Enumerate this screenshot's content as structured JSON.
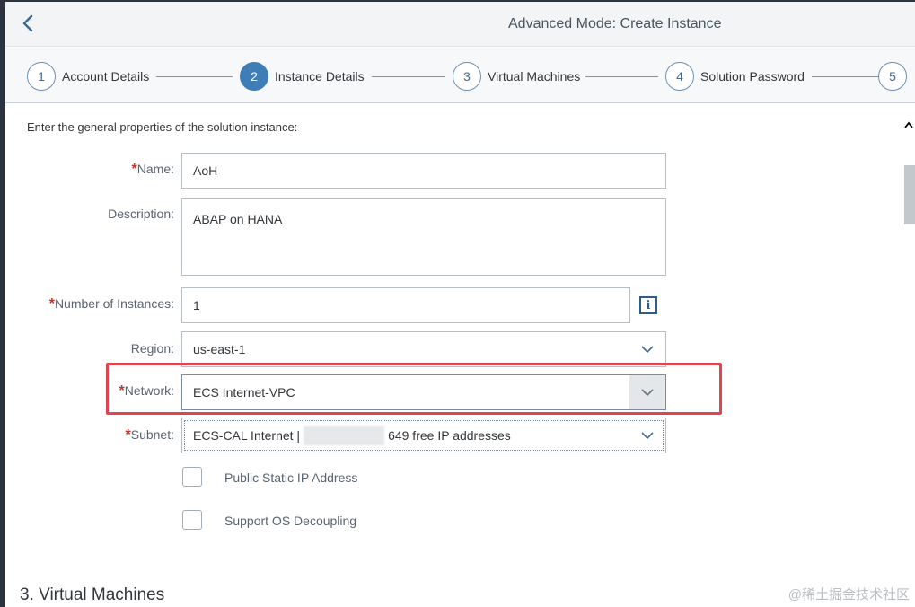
{
  "header": {
    "title": "Advanced Mode: Create Instance"
  },
  "wizard": {
    "steps": [
      {
        "number": "1",
        "label": "Account Details"
      },
      {
        "number": "2",
        "label": "Instance Details"
      },
      {
        "number": "3",
        "label": "Virtual Machines"
      },
      {
        "number": "4",
        "label": "Solution Password"
      },
      {
        "number": "5",
        "label": ""
      }
    ],
    "active_step": "2"
  },
  "form": {
    "intro": "Enter the general properties of the solution instance:",
    "required_mark": "*",
    "name": {
      "label": "Name:",
      "value": "AoH"
    },
    "description": {
      "label": "Description:",
      "value": "ABAP on HANA"
    },
    "instances": {
      "label": "Number of Instances:",
      "value": "1"
    },
    "region": {
      "label": "Region:",
      "value": "us-east-1"
    },
    "network": {
      "label": "Network:",
      "value": "ECS Internet-VPC"
    },
    "subnet": {
      "label": "Subnet:",
      "value_prefix": "ECS-CAL Internet |",
      "value_suffix": "649 free IP addresses"
    },
    "public_ip": {
      "label": "Public Static IP Address",
      "checked": false
    },
    "os_decoupling": {
      "label": "Support OS Decoupling",
      "checked": false
    }
  },
  "sections": {
    "next_title": "3. Virtual Machines"
  },
  "icons": {
    "back": "back-arrow-icon",
    "info": "info-icon",
    "dropdown": "chevron-down-icon",
    "scroll_up": "chevron-up-icon"
  },
  "info_glyph": "i",
  "watermark": "@稀土掘金技术社区",
  "colors": {
    "accent": "#3e7db5",
    "highlight": "#e0454f",
    "required": "#c0392b"
  }
}
